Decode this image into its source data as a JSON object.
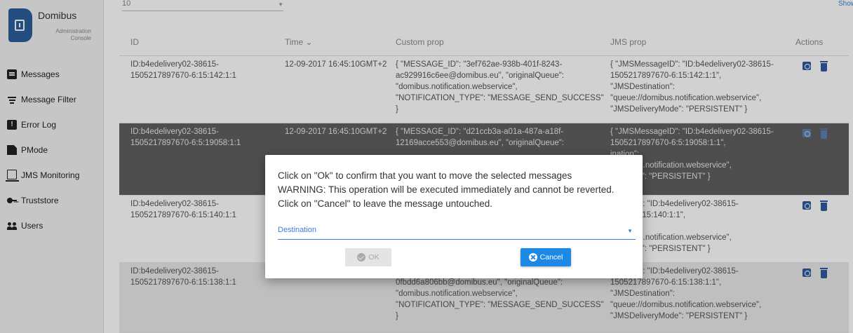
{
  "app": {
    "title": "Domibus",
    "subtitle": "Administration Console"
  },
  "sidebar": {
    "items": [
      {
        "label": "Messages",
        "icon": "messages-icon"
      },
      {
        "label": "Message Filter",
        "icon": "filter-icon"
      },
      {
        "label": "Error Log",
        "icon": "error-log-icon"
      },
      {
        "label": "PMode",
        "icon": "pmode-icon"
      },
      {
        "label": "JMS Monitoring",
        "icon": "monitor-icon"
      },
      {
        "label": "Truststore",
        "icon": "key-icon"
      },
      {
        "label": "Users",
        "icon": "users-icon"
      }
    ]
  },
  "toolbar": {
    "page_size": "10",
    "show_link": "Show"
  },
  "table": {
    "headers": {
      "id": "ID",
      "time": "Time ⌄",
      "custom": "Custom prop",
      "jms": "JMS prop",
      "actions": "Actions"
    },
    "rows": [
      {
        "id": "ID:b4edelivery02-38615-\n1505217897670-6:15:142:1:1",
        "time": "12-09-2017 16:45:10GMT+2",
        "custom": "{ \"MESSAGE_ID\": \"3ef762ae-938b-401f-8243-\nac929916c6ee@domibus.eu\", \"originalQueue\":\n\"domibus.notification.webservice\",\n\"NOTIFICATION_TYPE\": \"MESSAGE_SEND_SUCCESS\"\n}",
        "jms": "{ \"JMSMessageID\": \"ID:b4edelivery02-38615-\n1505217897670-6:15:142:1:1\",\n\"JMSDestination\":\n\"queue://domibus.notification.webservice\",\n\"JMSDeliveryMode\": \"PERSISTENT\" }"
      },
      {
        "id": "ID:b4edelivery02-38615-\n1505217897670-6:5:19058:1:1",
        "time": "12-09-2017 16:45:10GMT+2",
        "custom": "{ \"MESSAGE_ID\": \"d21ccb3a-a01a-487a-a18f-\n12169acce553@domibus.eu\", \"originalQueue\":",
        "jms": "{ \"JMSMessageID\": \"ID:b4edelivery02-38615-\n1505217897670-6:5:19058:1:1\",\nination\":\n:domibus.notification.webservice\",\neryMode\": \"PERSISTENT\" }"
      },
      {
        "id": "ID:b4edelivery02-38615-\n1505217897670-6:15:140:1:1",
        "time": "",
        "custom": "",
        "jms": "ssageID\": \"ID:b4edelivery02-38615-\n97670-6:15:140:1:1\",\nination\":\n:domibus.notification.webservice\",\neryMode\": \"PERSISTENT\" }"
      },
      {
        "id": "ID:b4edelivery02-38615-\n1505217897670-6:15:138:1:1",
        "time": "",
        "custom": "\n0fbdd6a806bb@domibus.eu\", \"originalQueue\":\n\"domibus.notification.webservice\",\n\"NOTIFICATION_TYPE\": \"MESSAGE_SEND_SUCCESS\"\n}",
        "jms": "ssageID\": \"ID:b4edelivery02-38615-\n1505217897670-6:15:138:1:1\",\n\"JMSDestination\":\n\"queue://domibus.notification.webservice\",\n\"JMSDeliveryMode\": \"PERSISTENT\" }"
      }
    ]
  },
  "dialog": {
    "line1": "Click on \"Ok\" to confirm that you want to move the selected messages",
    "line2": "WARNING: This operation will be executed immediately and cannot be reverted.",
    "line3": "Click on \"Cancel\" to leave the message untouched.",
    "destination_placeholder": "Destination",
    "ok_label": "OK",
    "cancel_label": "Cancel"
  },
  "colors": {
    "accent": "#1e88e5",
    "brand": "#2b5e9c",
    "selected_row": "#606060"
  }
}
